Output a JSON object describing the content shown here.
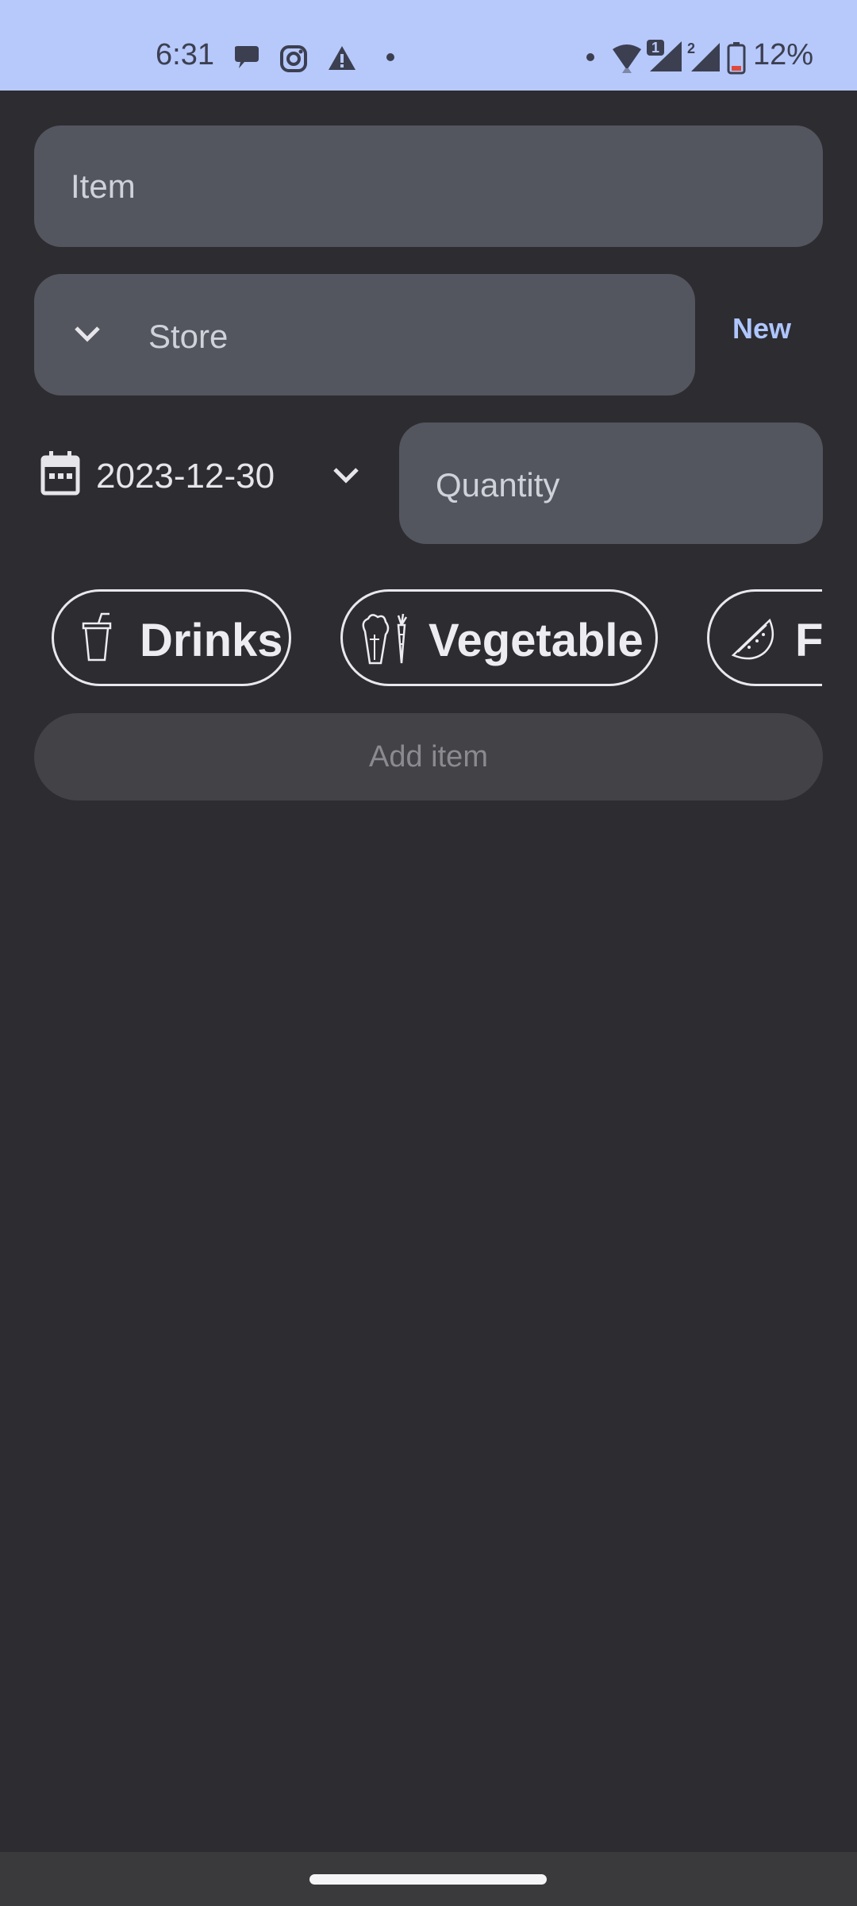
{
  "status_bar": {
    "time": "6:31",
    "battery_percent": "12%",
    "sim1_badge": "1",
    "sim2_badge": "2",
    "icons": [
      "chat-bubble-icon",
      "instagram-icon",
      "warning-icon",
      "dot-icon",
      "dot-icon",
      "wifi-icon",
      "signal-icon",
      "signal-icon",
      "battery-icon"
    ]
  },
  "form": {
    "item_placeholder": "Item",
    "store_placeholder": "Store",
    "new_store_label": "New",
    "date_value": "2023-12-30",
    "quantity_placeholder": "Quantity"
  },
  "categories": {
    "chips": [
      {
        "label": "Drinks",
        "icon": "drink-cup-icon"
      },
      {
        "label": "Vegetable",
        "icon": "vegetable-icon"
      },
      {
        "label": "F",
        "icon": "watermelon-icon"
      }
    ]
  },
  "actions": {
    "add_item_label": "Add item"
  },
  "colors": {
    "background": "#2d2c30",
    "status_bar": "#b7c8fb",
    "field": "#53565f",
    "accent": "#aec6ff"
  }
}
